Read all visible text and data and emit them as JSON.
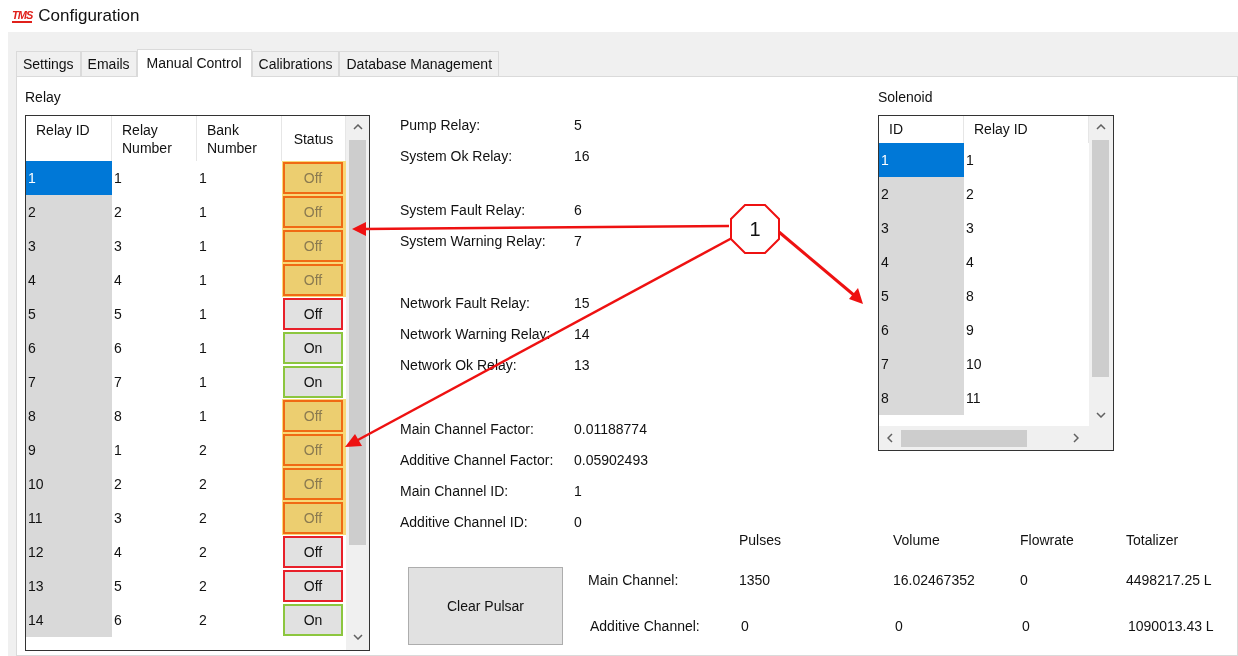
{
  "window": {
    "logo": "TMS",
    "title": "Configuration"
  },
  "tabs": [
    {
      "label": "Settings",
      "selected": false
    },
    {
      "label": "Emails",
      "selected": false
    },
    {
      "label": "Manual Control",
      "selected": true
    },
    {
      "label": "Calibrations",
      "selected": false
    },
    {
      "label": "Database Management",
      "selected": false
    }
  ],
  "relay": {
    "title": "Relay",
    "columns": [
      "Relay ID",
      "Relay Number",
      "Bank Number",
      "Status"
    ],
    "rows": [
      {
        "relay_id": "1",
        "relay_number": "1",
        "bank_number": "1",
        "status": "Off",
        "on": false,
        "highlighted": true,
        "selected": true
      },
      {
        "relay_id": "2",
        "relay_number": "2",
        "bank_number": "1",
        "status": "Off",
        "on": false,
        "highlighted": true,
        "selected": false
      },
      {
        "relay_id": "3",
        "relay_number": "3",
        "bank_number": "1",
        "status": "Off",
        "on": false,
        "highlighted": true,
        "selected": false
      },
      {
        "relay_id": "4",
        "relay_number": "4",
        "bank_number": "1",
        "status": "Off",
        "on": false,
        "highlighted": true,
        "selected": false
      },
      {
        "relay_id": "5",
        "relay_number": "5",
        "bank_number": "1",
        "status": "Off",
        "on": false,
        "highlighted": false,
        "selected": false
      },
      {
        "relay_id": "6",
        "relay_number": "6",
        "bank_number": "1",
        "status": "On",
        "on": true,
        "highlighted": false,
        "selected": false
      },
      {
        "relay_id": "7",
        "relay_number": "7",
        "bank_number": "1",
        "status": "On",
        "on": true,
        "highlighted": false,
        "selected": false
      },
      {
        "relay_id": "8",
        "relay_number": "8",
        "bank_number": "1",
        "status": "Off",
        "on": false,
        "highlighted": true,
        "selected": false
      },
      {
        "relay_id": "9",
        "relay_number": "1",
        "bank_number": "2",
        "status": "Off",
        "on": false,
        "highlighted": true,
        "selected": false
      },
      {
        "relay_id": "10",
        "relay_number": "2",
        "bank_number": "2",
        "status": "Off",
        "on": false,
        "highlighted": true,
        "selected": false
      },
      {
        "relay_id": "11",
        "relay_number": "3",
        "bank_number": "2",
        "status": "Off",
        "on": false,
        "highlighted": true,
        "selected": false
      },
      {
        "relay_id": "12",
        "relay_number": "4",
        "bank_number": "2",
        "status": "Off",
        "on": false,
        "highlighted": false,
        "selected": false
      },
      {
        "relay_id": "13",
        "relay_number": "5",
        "bank_number": "2",
        "status": "Off",
        "on": false,
        "highlighted": false,
        "selected": false
      },
      {
        "relay_id": "14",
        "relay_number": "6",
        "bank_number": "2",
        "status": "On",
        "on": true,
        "highlighted": false,
        "selected": false
      }
    ]
  },
  "relay_settings": [
    {
      "items": [
        {
          "label": "Pump Relay:",
          "value": "5"
        },
        {
          "label": "System Ok Relay:",
          "value": "16"
        }
      ]
    },
    {
      "items": [
        {
          "label": "System Fault Relay:",
          "value": "6"
        },
        {
          "label": "System Warning Relay:",
          "value": "7"
        }
      ]
    },
    {
      "items": [
        {
          "label": "Network Fault Relay:",
          "value": "15"
        },
        {
          "label": "Network Warning Relay:",
          "value": "14"
        },
        {
          "label": "Network Ok Relay:",
          "value": "13"
        }
      ]
    },
    {
      "items": [
        {
          "label": "Main Channel Factor:",
          "value": "0.01188774"
        },
        {
          "label": "Additive Channel Factor:",
          "value": "0.05902493"
        },
        {
          "label": "Main Channel ID:",
          "value": "1"
        },
        {
          "label": "Additive Channel ID:",
          "value": "0"
        }
      ]
    }
  ],
  "solenoid": {
    "title": "Solenoid",
    "columns": [
      "ID",
      "Relay ID"
    ],
    "rows": [
      {
        "id": "1",
        "relay_id": "1",
        "selected": true
      },
      {
        "id": "2",
        "relay_id": "2",
        "selected": false
      },
      {
        "id": "3",
        "relay_id": "3",
        "selected": false
      },
      {
        "id": "4",
        "relay_id": "4",
        "selected": false
      },
      {
        "id": "5",
        "relay_id": "8",
        "selected": false
      },
      {
        "id": "6",
        "relay_id": "9",
        "selected": false
      },
      {
        "id": "7",
        "relay_id": "10",
        "selected": false
      },
      {
        "id": "8",
        "relay_id": "11",
        "selected": false
      }
    ]
  },
  "pulsar": {
    "button": "Clear Pulsar",
    "columns": [
      "Pulses",
      "Volume",
      "Flowrate",
      "Totalizer"
    ],
    "rows": [
      {
        "label": "Main Channel:",
        "values": [
          "1350",
          "16.02467352",
          "0",
          "4498217.25 L"
        ]
      },
      {
        "label": "Additive Channel:",
        "values": [
          "0",
          "0",
          "0",
          "1090013.43 L"
        ]
      }
    ]
  },
  "annotation": {
    "callout": "1"
  }
}
